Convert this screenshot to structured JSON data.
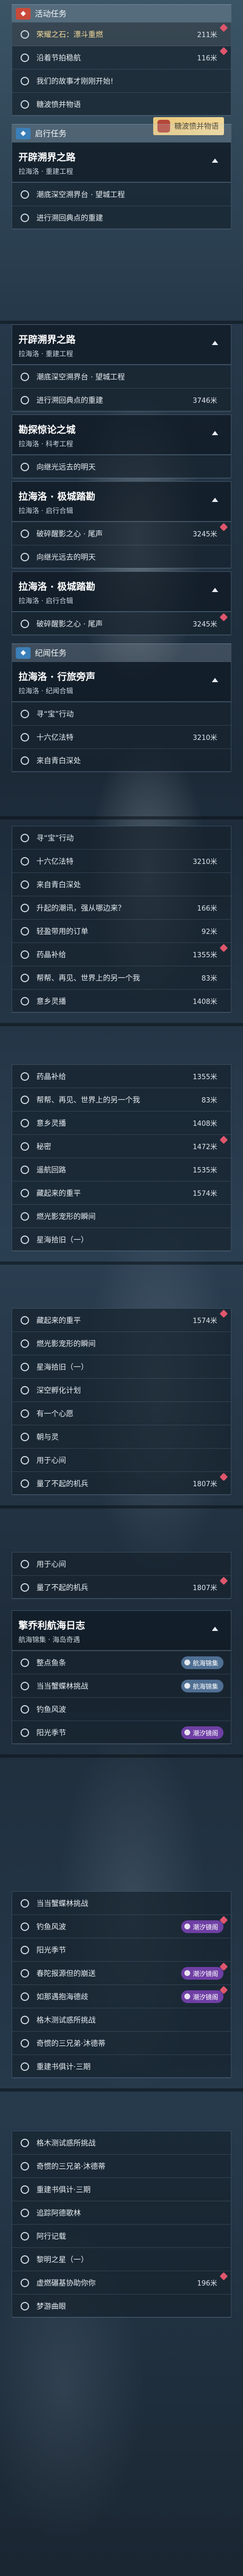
{
  "colors": {
    "accent_red": "#c94a3a",
    "accent_blue": "#3b7fb8",
    "accent_purple": "#6f3fa5",
    "tag_gold": "#f1d796"
  },
  "screens": [
    {
      "event_section": {
        "title": "活动任务",
        "icon": "event-flag-icon"
      },
      "event_rows": [
        {
          "label": "荣耀之石：漂斗重燃",
          "dist": "211米"
        },
        {
          "label": "沿着节拍稳航",
          "dist": "116米"
        },
        {
          "label": "我们的故事才刚刚开始!",
          "dist": ""
        },
        {
          "label": "糖波愤并物语",
          "dist": ""
        }
      ],
      "event_tag": "糖波愤并物语",
      "journey_section": {
        "title": "启行任务",
        "icon": "journey-icon"
      },
      "quest1": {
        "title": "开辟溯界之路",
        "subtitle": "拉海洛 · 重建工程"
      },
      "quest1_rows": [
        {
          "label": "潮底深空溯界台 · 望城工程",
          "dist": ""
        },
        {
          "label": "进行溯回典点的重建",
          "dist": ""
        }
      ]
    },
    {
      "quest1": {
        "title": "开辟溯界之路",
        "subtitle": "拉海洛 · 重建工程"
      },
      "quest1_rows": [
        {
          "label": "潮底深空溯界台 · 望城工程",
          "dist": ""
        },
        {
          "label": "进行溯回典点的重建",
          "dist": "3746米"
        }
      ],
      "quest2": {
        "title": "勘探惊论之城",
        "subtitle": "拉海洛 · 科考工程"
      },
      "quest2_rows": [
        {
          "label": "向继光远去的明天",
          "dist": ""
        }
      ],
      "quest3": {
        "title": "拉海洛 · 极城踏勘",
        "subtitle": "拉海洛 · 启行合辑"
      },
      "quest3_rows": [
        {
          "label": "破碎醒影之心 · 尾声",
          "dist": "3245米"
        },
        {
          "label": "向继光远去的明天",
          "dist": ""
        }
      ],
      "quest4": {
        "title": "拉海洛 · 极城踏勘",
        "subtitle": "拉海洛 · 启行合辑"
      },
      "quest4_rows": [
        {
          "label": "破碎醒影之心 · 尾声",
          "dist": "3245米"
        }
      ],
      "legend_section": {
        "title": "纪闻任务",
        "icon": "legend-book-icon"
      },
      "quest5": {
        "title": "拉海洛 · 行旅旁声",
        "subtitle": "拉海洛 · 纪闻合辑"
      },
      "quest5_rows": [
        {
          "label": "寻“宝”行动",
          "dist": ""
        },
        {
          "label": "十六亿法特",
          "dist": "3210米"
        },
        {
          "label": "来自青白深处",
          "dist": ""
        }
      ]
    },
    {
      "rows": [
        {
          "label": "寻“宝”行动",
          "dist": ""
        },
        {
          "label": "十六亿法特",
          "dist": "3210米"
        },
        {
          "label": "来自青白深处",
          "dist": ""
        },
        {
          "label": "升起的潮讯，强从哪边来？",
          "dist": "166米"
        },
        {
          "label": "轻盈带用的订单",
          "dist": "92米"
        },
        {
          "label": "药晶补给",
          "dist": "1355米"
        },
        {
          "label": "帮帮、再见、世界上的另一个我",
          "dist": "83米"
        },
        {
          "label": "意乡灵播",
          "dist": "1408米"
        }
      ]
    },
    {
      "rows": [
        {
          "label": "药晶补给",
          "dist": "1355米"
        },
        {
          "label": "帮帮、再见、世界上的另一个我",
          "dist": "83米"
        },
        {
          "label": "意乡灵播",
          "dist": "1408米"
        },
        {
          "label": "秘密",
          "dist": "1472米"
        },
        {
          "label": "遥航回路",
          "dist": "1535米"
        },
        {
          "label": "藏起来的重平",
          "dist": "1574米"
        },
        {
          "label": "燃光影宠形的瞬间",
          "dist": ""
        },
        {
          "label": "星海拾旧（一）",
          "dist": ""
        }
      ]
    },
    {
      "rows": [
        {
          "label": "藏起来的重平",
          "dist": "1574米"
        },
        {
          "label": "燃光影宠形的瞬间",
          "dist": ""
        },
        {
          "label": "星海拾旧（一）",
          "dist": ""
        },
        {
          "label": "深空孵化计划",
          "dist": ""
        },
        {
          "label": "有一个心愿",
          "dist": ""
        },
        {
          "label": "朝与灵",
          "dist": ""
        },
        {
          "label": "用于心间",
          "dist": ""
        },
        {
          "label": "量了不起的机兵",
          "dist": "1807米"
        }
      ]
    },
    {
      "rows": [
        {
          "label": "用于心间",
          "dist": ""
        },
        {
          "label": "量了不起的机兵",
          "dist": "1807米"
        }
      ],
      "quest6": {
        "title": "擎乔利航海日志",
        "subtitle": "航海锦集 · 海岛奇遇"
      },
      "quest6_rows": [
        {
          "label": "整点鱼条",
          "dist": "",
          "chip": "航海锦集",
          "chip_color": "blue"
        },
        {
          "label": "当当蟹蝶林挑战",
          "dist": "",
          "chip": "航海锦集",
          "chip_color": "blue"
        },
        {
          "label": "钓鱼风波",
          "dist": "",
          "chip": "",
          "chip_color": ""
        },
        {
          "label": "阳光季节",
          "dist": "",
          "chip": "潮汐镜阁",
          "chip_color": "purple"
        }
      ]
    },
    {
      "rows": [
        {
          "label": "当当蟹蝶林挑战",
          "dist": "",
          "chip": "",
          "chip_color": ""
        },
        {
          "label": "钓鱼风波",
          "dist": "",
          "chip": "潮汐镜阁",
          "chip_color": "purple"
        },
        {
          "label": "阳光季节",
          "dist": "",
          "chip": "",
          "chip_color": ""
        },
        {
          "label": "春陀报源但的崩送",
          "dist": "104米",
          "chip": "潮汐镜阁",
          "chip_color": "purple"
        },
        {
          "label": "如那遇抱海德歧",
          "dist": "",
          "chip": "潮汐镜阁",
          "chip_color": "purple"
        },
        {
          "label": "格木测试惑所挑战",
          "dist": "",
          "chip": "",
          "chip_color": ""
        },
        {
          "label": "奇惯的三兄弟·沐德蒂",
          "dist": "",
          "chip": "",
          "chip_color": ""
        },
        {
          "label": "重建书俱计·三期",
          "dist": "",
          "chip": "",
          "chip_color": ""
        }
      ]
    },
    {
      "rows": [
        {
          "label": "格木测试惑所挑战",
          "dist": ""
        },
        {
          "label": "奇惯的三兄弟·沐德蒂",
          "dist": ""
        },
        {
          "label": "重建书俱计·三期",
          "dist": ""
        },
        {
          "label": "追踪阿德歌林",
          "dist": ""
        },
        {
          "label": "阿行记载",
          "dist": ""
        },
        {
          "label": "黎明之星（一）",
          "dist": ""
        },
        {
          "label": "虚燃碾基协助你你",
          "dist": "196米"
        },
        {
          "label": "梦游曲眼",
          "dist": ""
        }
      ]
    }
  ]
}
